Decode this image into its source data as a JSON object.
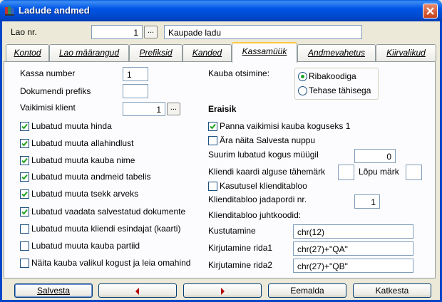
{
  "window": {
    "title": "Ladude andmed"
  },
  "header": {
    "lao_nr_label": "Lao nr.",
    "lao_nr_value": "1",
    "lao_name_value": "Kaupade ladu"
  },
  "tabs": [
    {
      "label": "Kontod"
    },
    {
      "label": "Lao määrangud"
    },
    {
      "label": "Prefiksid"
    },
    {
      "label": "Kanded"
    },
    {
      "label": "Kassamüük",
      "active": true
    },
    {
      "label": "Andmevahetus"
    },
    {
      "label": "Kiirvalikud"
    }
  ],
  "left": {
    "kassa_number_label": "Kassa number",
    "kassa_number_value": "1",
    "dok_prefiks_label": "Dokumendi prefiks",
    "dok_prefiks_value": "",
    "vaikimisi_klient_label": "Vaikimisi klient",
    "vaikimisi_klient_value": "1",
    "checkboxes": [
      {
        "label": "Lubatud muuta hinda",
        "checked": true
      },
      {
        "label": "Lubatud muuta allahindlust",
        "checked": true
      },
      {
        "label": "Lubatud muuta kauba nime",
        "checked": true
      },
      {
        "label": "Lubatud muuta andmeid tabelis",
        "checked": true
      },
      {
        "label": "Lubatud muuta tsekk arveks",
        "checked": true
      },
      {
        "label": "Lubatud vaadata salvestatud dokumente",
        "checked": true
      },
      {
        "label": "Lubatud muuta kliendi esindajat (kaarti)",
        "checked": false
      },
      {
        "label": "Lubatud muuta kauba partiid",
        "checked": false
      },
      {
        "label": "Näita kauba valikul kogust ja leia omahind",
        "checked": false
      }
    ]
  },
  "right": {
    "kauba_otsimine_label": "Kauba otsimine:",
    "radios": [
      {
        "label": "Ribakoodiga",
        "selected": true
      },
      {
        "label": "Tehase tähisega",
        "selected": false
      }
    ],
    "eraisik_heading": "Eraisik",
    "cb_panna": {
      "label": "Panna vaikimisi kauba koguseks 1",
      "checked": true
    },
    "cb_ara": {
      "label": "Ära näita Salvesta nuppu",
      "checked": false
    },
    "suurim_label": "Suurim lubatud kogus müügil",
    "suurim_value": "0",
    "kaardi_algus_label": "Kliendi kaardi alguse tähemärk",
    "kaardi_algus_value": "",
    "lopu_label": "Lõpu märk",
    "lopu_value": "",
    "cb_kasutusel": {
      "label": "Kasutusel klienditabloo",
      "checked": false
    },
    "jadapordi_label": "Klienditabloo jadapordi nr.",
    "jadapordi_value": "1",
    "juhtkoodid_label": "Klienditabloo juhtkoodid:",
    "kustutamine_label": "Kustutamine",
    "kustutamine_value": "chr(12)",
    "rida1_label": "Kirjutamine rida1",
    "rida1_value": "chr(27)+\"QA\"",
    "rida2_label": "Kirjutamine rida2",
    "rida2_value": "chr(27)+\"QB\""
  },
  "buttons": {
    "salvesta": "Salvesta",
    "eemalda": "Eemalda",
    "katkesta": "Katkesta"
  },
  "colors": {
    "titlebar": "#0055E5",
    "active_tab_accent": "#FFC73C",
    "check": "#21A121",
    "arrow": "#B40000"
  },
  "icons": {
    "app": "app-icon",
    "close": "close-icon",
    "prev": "arrow-left-icon",
    "next": "arrow-right-icon"
  }
}
